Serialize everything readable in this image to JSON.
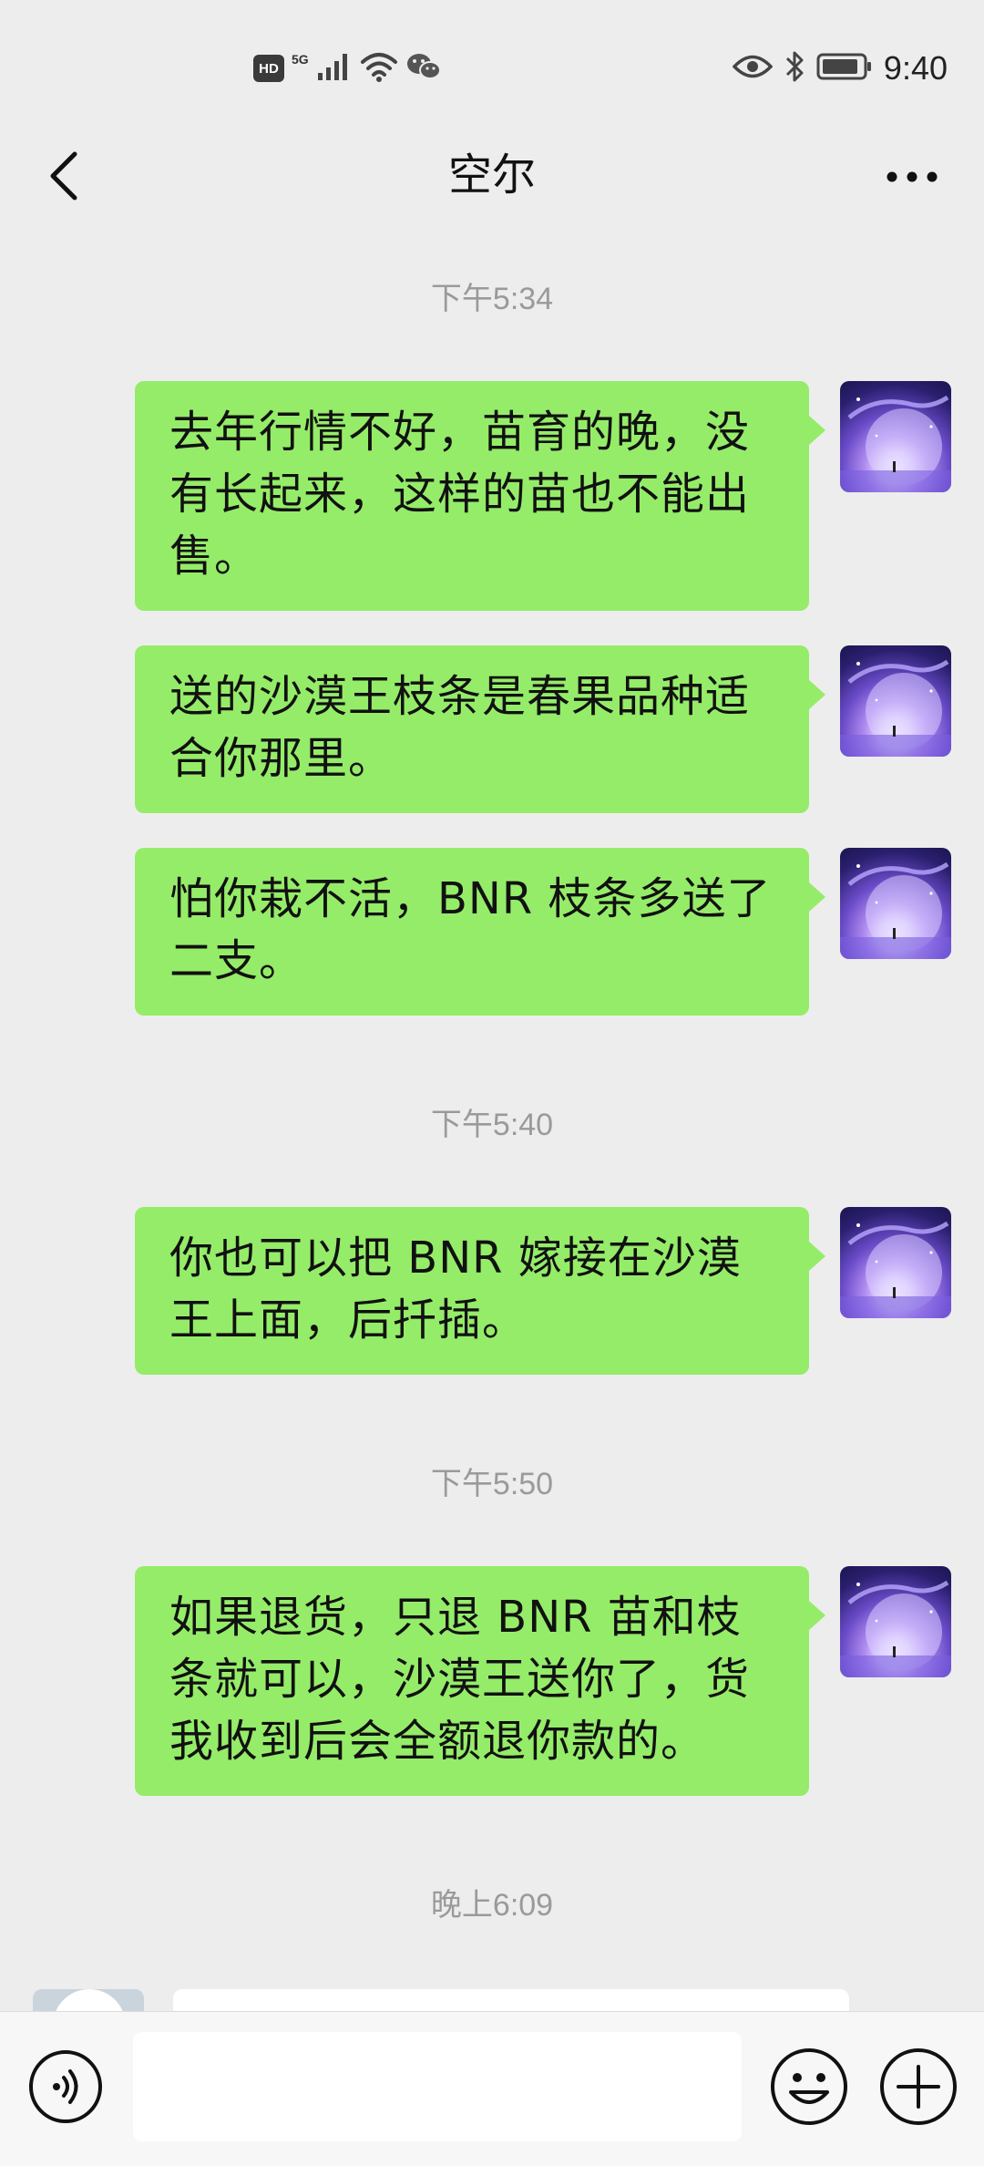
{
  "status_bar": {
    "hd_label": "HD",
    "network_label": "5G",
    "time": "9:40"
  },
  "title_bar": {
    "title": "空尔"
  },
  "messages": [
    {
      "timestamp": "下午5:34"
    },
    {
      "text": "去年行情不好，苗育的晚，没有长起来，这样的苗也不能出售。"
    },
    {
      "text": "送的沙漠王枝条是春果品种适合你那里。"
    },
    {
      "text": "怕你栽不活，BNR 枝条多送了二支。"
    },
    {
      "timestamp": "下午5:40"
    },
    {
      "text": "你也可以把 BNR 嫁接在沙漠王上面，后扦插。"
    },
    {
      "timestamp": "下午5:50"
    },
    {
      "text": "如果退货，只退 BNR 苗和枝条就可以，沙漠王送你了，货我收到后会全额退你款的。"
    },
    {
      "timestamp": "晚上6:09"
    }
  ],
  "input_bar": {
    "value": ""
  },
  "colors": {
    "background": "#ededed",
    "sent_bubble": "#95ec69",
    "timestamp_text": "#9a9a9a"
  },
  "icons": [
    "back-arrow-icon",
    "more-dots-icon",
    "voice-icon",
    "emoji-icon",
    "plus-icon",
    "wifi-icon",
    "eye-icon",
    "bluetooth-icon",
    "battery-icon",
    "wechat-icon",
    "signal-icon"
  ]
}
